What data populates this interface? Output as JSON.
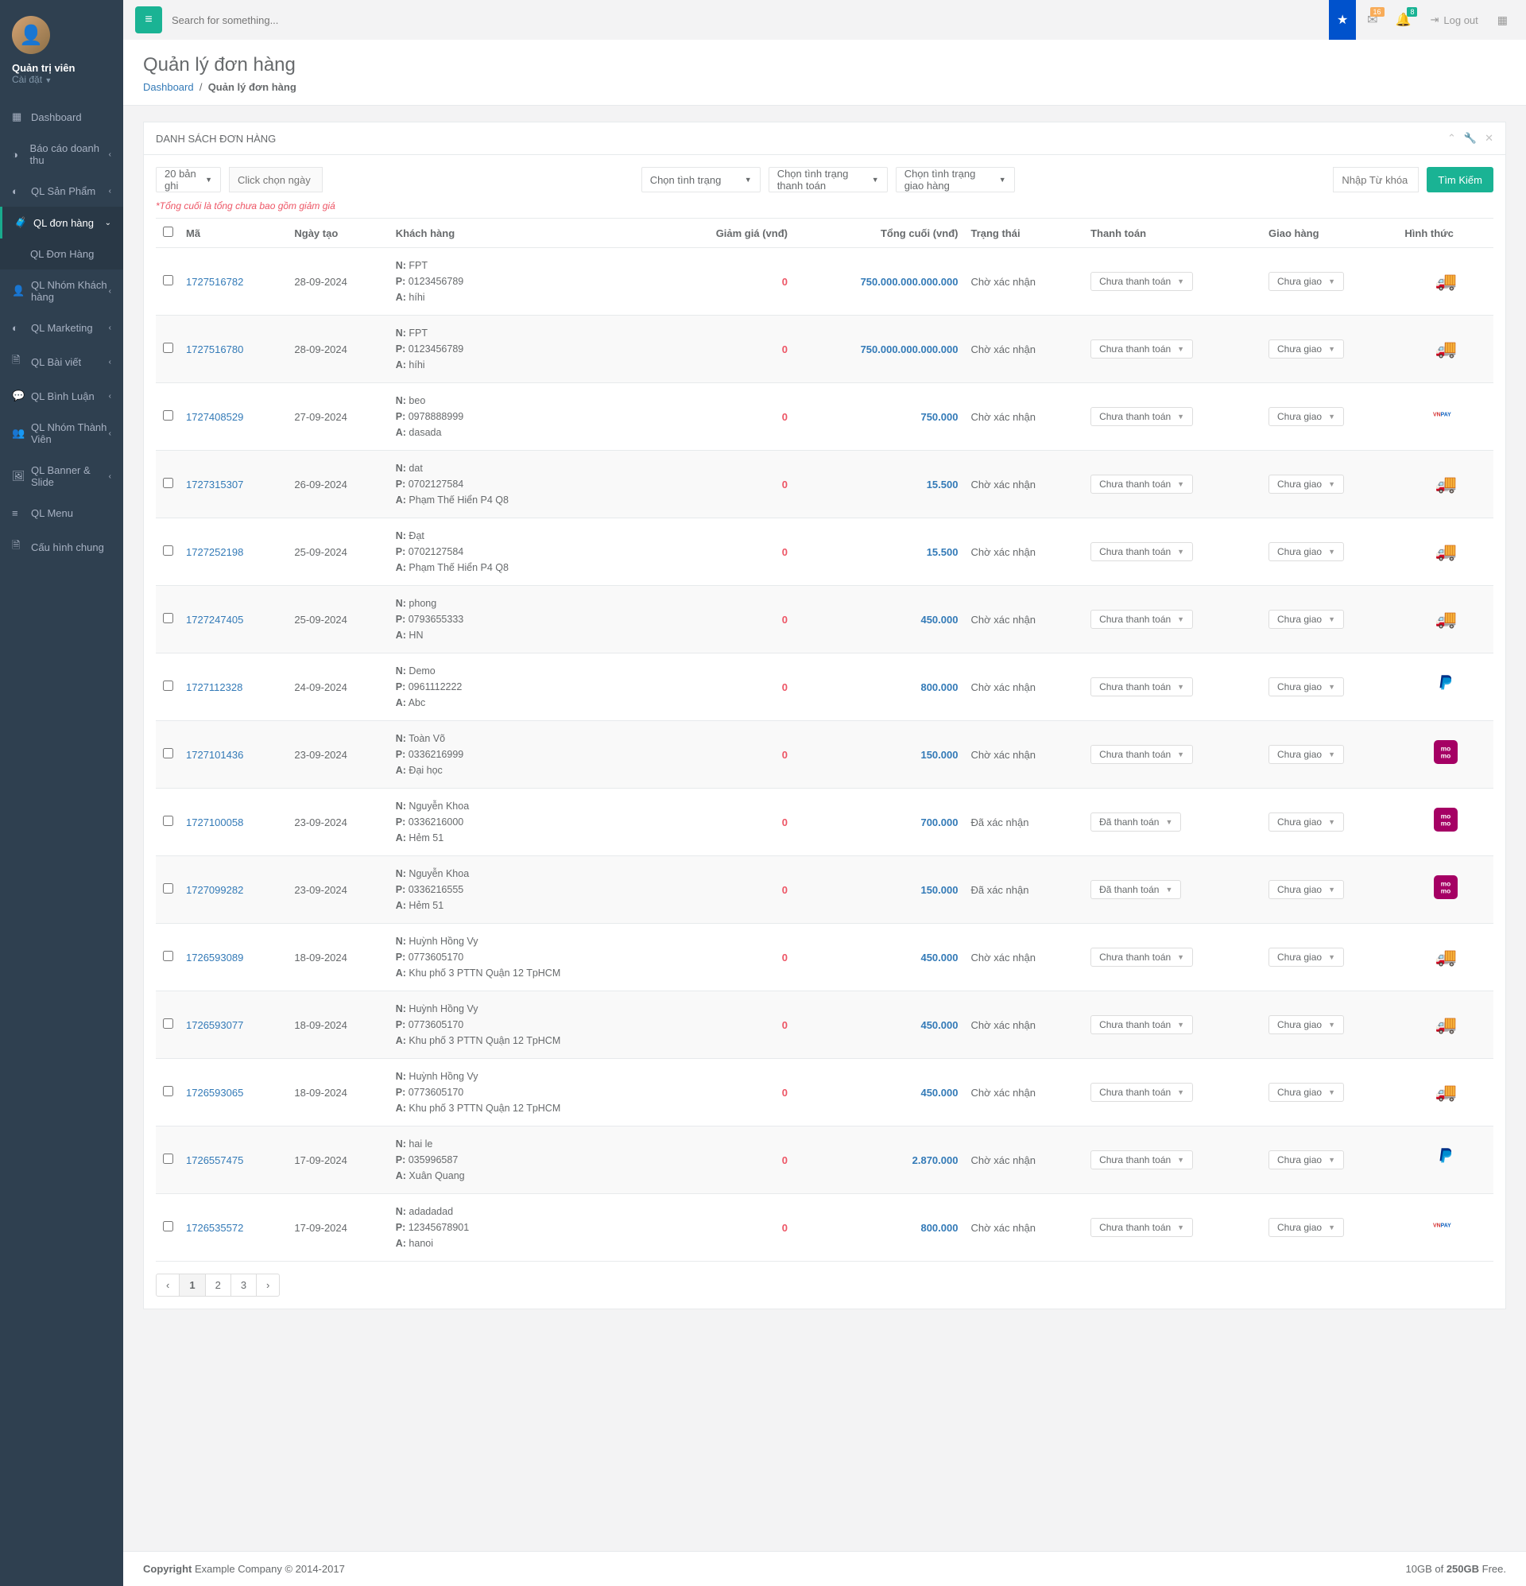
{
  "profile": {
    "name": "Quản trị viên",
    "role": "Cài đặt"
  },
  "sidebar": {
    "items": [
      {
        "icon": "▦",
        "label": "Dashboard",
        "chev": false
      },
      {
        "icon": "◑",
        "label": "Báo cáo doanh thu",
        "chev": true
      },
      {
        "icon": "◐",
        "label": "QL Sản Phẩm",
        "chev": true
      },
      {
        "icon": "🧳",
        "label": "QL đơn hàng",
        "chev": true,
        "active": true
      },
      {
        "icon": "👤",
        "label": "QL Nhóm Khách hàng",
        "chev": true
      },
      {
        "icon": "◐",
        "label": "QL Marketing",
        "chev": true
      },
      {
        "icon": "🗎",
        "label": "QL Bài viết",
        "chev": true
      },
      {
        "icon": "💬",
        "label": "QL Bình Luận",
        "chev": true
      },
      {
        "icon": "👥",
        "label": "QL Nhóm Thành Viên",
        "chev": true
      },
      {
        "icon": "🖼",
        "label": "QL Banner & Slide",
        "chev": true
      },
      {
        "icon": "≡",
        "label": "QL Menu"
      },
      {
        "icon": "🗎",
        "label": "Cấu hình chung"
      }
    ],
    "sub_label": "QL Đơn Hàng"
  },
  "topbar": {
    "search_placeholder": "Search for something...",
    "badge1": "16",
    "badge2": "8",
    "logout_label": "Log out"
  },
  "heading": {
    "title": "Quản lý đơn hàng",
    "bc1": "Dashboard",
    "bc2": "Quản lý đơn hàng"
  },
  "panel": {
    "title": "DANH SÁCH ĐƠN HÀNG",
    "note": "*Tổng cuối là tổng chưa bao gồm giảm giá"
  },
  "filters": {
    "per_page": "20 bản ghi",
    "date_ph": "Click chọn ngày",
    "status": "Chọn tình trạng",
    "pay_status": "Chọn tình trạng thanh toán",
    "ship_status": "Chọn tình trạng giao hàng",
    "keyword_ph": "Nhập Từ khóa bạn muốn",
    "btn": "Tìm Kiếm"
  },
  "cols": {
    "code": "Mã",
    "created": "Ngày tạo",
    "customer": "Khách hàng",
    "discount": "Giảm giá (vnđ)",
    "total": "Tổng cuối (vnđ)",
    "status": "Trạng thái",
    "payment": "Thanh toán",
    "shipping": "Giao hàng",
    "method": "Hình thức"
  },
  "rows": [
    {
      "code": "1727516782",
      "date": "28-09-2024",
      "n": "FPT",
      "p": "0123456789",
      "a": "híhi",
      "disc": "0",
      "total": "750.000.000.000.000",
      "status": "Chờ xác nhận",
      "pay": "Chưa thanh toán",
      "ship": "Chưa giao",
      "pm": "truck"
    },
    {
      "code": "1727516780",
      "date": "28-09-2024",
      "n": "FPT",
      "p": "0123456789",
      "a": "híhi",
      "disc": "0",
      "total": "750.000.000.000.000",
      "status": "Chờ xác nhận",
      "pay": "Chưa thanh toán",
      "ship": "Chưa giao",
      "pm": "truck"
    },
    {
      "code": "1727408529",
      "date": "27-09-2024",
      "n": "beo",
      "p": "0978888999",
      "a": "dasada",
      "disc": "0",
      "total": "750.000",
      "status": "Chờ xác nhận",
      "pay": "Chưa thanh toán",
      "ship": "Chưa giao",
      "pm": "vnpay"
    },
    {
      "code": "1727315307",
      "date": "26-09-2024",
      "n": "dat",
      "p": "0702127584",
      "a": "Phạm Thế Hiển P4 Q8",
      "disc": "0",
      "total": "15.500",
      "status": "Chờ xác nhận",
      "pay": "Chưa thanh toán",
      "ship": "Chưa giao",
      "pm": "truck"
    },
    {
      "code": "1727252198",
      "date": "25-09-2024",
      "n": "Đạt",
      "p": "0702127584",
      "a": "Phạm Thế Hiển P4 Q8",
      "disc": "0",
      "total": "15.500",
      "status": "Chờ xác nhận",
      "pay": "Chưa thanh toán",
      "ship": "Chưa giao",
      "pm": "truck"
    },
    {
      "code": "1727247405",
      "date": "25-09-2024",
      "n": "phong",
      "p": "0793655333",
      "a": "HN",
      "disc": "0",
      "total": "450.000",
      "status": "Chờ xác nhận",
      "pay": "Chưa thanh toán",
      "ship": "Chưa giao",
      "pm": "truck"
    },
    {
      "code": "1727112328",
      "date": "24-09-2024",
      "n": "Demo",
      "p": "0961112222",
      "a": "Abc",
      "disc": "0",
      "total": "800.000",
      "status": "Chờ xác nhận",
      "pay": "Chưa thanh toán",
      "ship": "Chưa giao",
      "pm": "paypal"
    },
    {
      "code": "1727101436",
      "date": "23-09-2024",
      "n": "Toàn Võ",
      "p": "0336216999",
      "a": "Đại học",
      "disc": "0",
      "total": "150.000",
      "status": "Chờ xác nhận",
      "pay": "Chưa thanh toán",
      "ship": "Chưa giao",
      "pm": "momo"
    },
    {
      "code": "1727100058",
      "date": "23-09-2024",
      "n": "Nguyễn Khoa",
      "p": "0336216000",
      "a": "Hẻm 51",
      "disc": "0",
      "total": "700.000",
      "status": "Đã xác nhận",
      "pay": "Đã thanh toán",
      "ship": "Chưa giao",
      "pm": "momo"
    },
    {
      "code": "1727099282",
      "date": "23-09-2024",
      "n": "Nguyễn Khoa",
      "p": "0336216555",
      "a": "Hẻm 51",
      "disc": "0",
      "total": "150.000",
      "status": "Đã xác nhận",
      "pay": "Đã thanh toán",
      "ship": "Chưa giao",
      "pm": "momo"
    },
    {
      "code": "1726593089",
      "date": "18-09-2024",
      "n": "Huỳnh Hồng Vy",
      "p": "0773605170",
      "a": "Khu phố 3 PTTN Quận 12 TpHCM",
      "disc": "0",
      "total": "450.000",
      "status": "Chờ xác nhận",
      "pay": "Chưa thanh toán",
      "ship": "Chưa giao",
      "pm": "truck"
    },
    {
      "code": "1726593077",
      "date": "18-09-2024",
      "n": "Huỳnh Hồng Vy",
      "p": "0773605170",
      "a": "Khu phố 3 PTTN Quận 12 TpHCM",
      "disc": "0",
      "total": "450.000",
      "status": "Chờ xác nhận",
      "pay": "Chưa thanh toán",
      "ship": "Chưa giao",
      "pm": "truck"
    },
    {
      "code": "1726593065",
      "date": "18-09-2024",
      "n": "Huỳnh Hồng Vy",
      "p": "0773605170",
      "a": "Khu phố 3 PTTN Quận 12 TpHCM",
      "disc": "0",
      "total": "450.000",
      "status": "Chờ xác nhận",
      "pay": "Chưa thanh toán",
      "ship": "Chưa giao",
      "pm": "truck"
    },
    {
      "code": "1726557475",
      "date": "17-09-2024",
      "n": "hai le",
      "p": "035996587",
      "a": "Xuân Quang",
      "disc": "0",
      "total": "2.870.000",
      "status": "Chờ xác nhận",
      "pay": "Chưa thanh toán",
      "ship": "Chưa giao",
      "pm": "paypal"
    },
    {
      "code": "1726535572",
      "date": "17-09-2024",
      "n": "adadadad",
      "p": "12345678901",
      "a": "hanoi",
      "disc": "0",
      "total": "800.000",
      "status": "Chờ xác nhận",
      "pay": "Chưa thanh toán",
      "ship": "Chưa giao",
      "pm": "vnpay"
    }
  ],
  "pager": {
    "prev": "‹",
    "p1": "1",
    "p2": "2",
    "p3": "3",
    "next": "›"
  },
  "footer": {
    "left_strong": "Copyright",
    "left": " Example Company © 2014-2017",
    "right_a": "10GB of ",
    "right_b": "250GB",
    "right_c": " Free."
  }
}
